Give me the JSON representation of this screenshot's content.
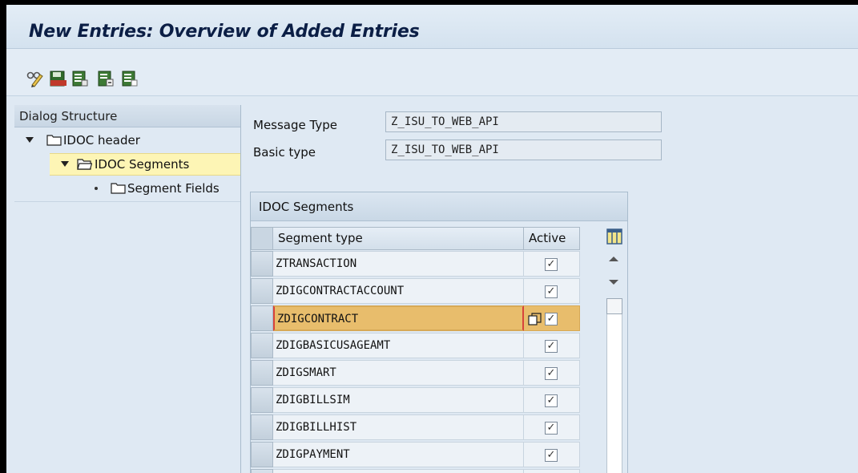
{
  "window": {
    "title": "New Entries: Overview of Added Entries"
  },
  "toolbar": {
    "icons": [
      "change-display-icon",
      "save-icon",
      "select-all-icon",
      "select-block-icon",
      "deselect-all-icon"
    ]
  },
  "dialog_structure": {
    "header": "Dialog Structure",
    "items": [
      {
        "label": "IDOC header",
        "expanded": true
      },
      {
        "label": "IDOC Segments",
        "expanded": true,
        "selected": true
      },
      {
        "label": "Segment Fields"
      }
    ]
  },
  "form": {
    "message_type_label": "Message Type",
    "message_type_value": "Z_ISU_TO_WEB_API",
    "basic_type_label": "Basic type",
    "basic_type_value": "Z_ISU_TO_WEB_API"
  },
  "table": {
    "title": "IDOC Segments",
    "columns": [
      "Segment type",
      "Active"
    ],
    "rows": [
      {
        "segment_type": "ZTRANSACTION",
        "active": "✓"
      },
      {
        "segment_type": "ZDIGCONTRACTACCOUNT",
        "active": "✓"
      },
      {
        "segment_type": "ZDIGCONTRACT",
        "active": "✓",
        "selected": true
      },
      {
        "segment_type": "ZDIGBASICUSAGEAMT",
        "active": "✓"
      },
      {
        "segment_type": "ZDIGSMART",
        "active": "✓"
      },
      {
        "segment_type": "ZDIGBILLSIM",
        "active": "✓"
      },
      {
        "segment_type": "ZDIGBILLHIST",
        "active": "✓"
      },
      {
        "segment_type": "ZDIGPAYMENT",
        "active": "✓"
      }
    ]
  },
  "colors": {
    "background": "#dfe9f3",
    "title_text": "#0b1e45",
    "selected_tree_item": "#fdf5b5",
    "selected_row": "#e8bd6c"
  }
}
